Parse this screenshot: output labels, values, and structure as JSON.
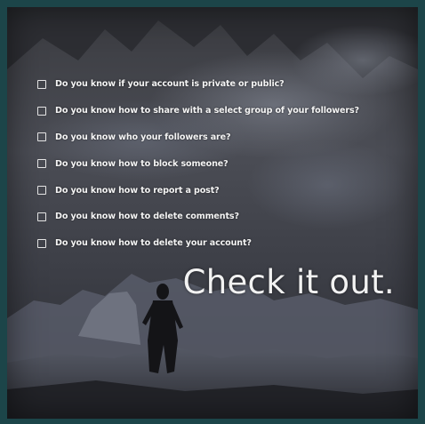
{
  "checklist": {
    "items": [
      "Do you know if your account is private or public?",
      "Do you know how to share with a select group of your followers?",
      "Do you know who your followers are?",
      "Do you know how to block someone?",
      "Do you know how to report a post?",
      "Do you know how to delete comments?",
      "Do you know how to delete your account?"
    ]
  },
  "cta": {
    "text": "Check it out."
  },
  "colors": {
    "frame": "#1c4549",
    "text": "#f4f4f4"
  }
}
